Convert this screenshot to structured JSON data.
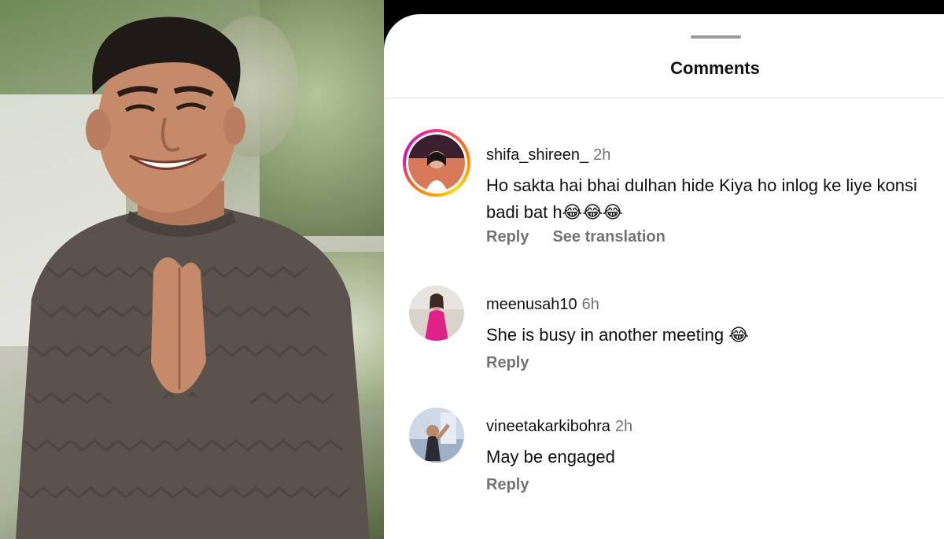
{
  "sheet": {
    "title": "Comments"
  },
  "comments": [
    {
      "username": "shifa_shireen_",
      "time": "2h",
      "text": "Ho sakta hai bhai dulhan hide Kiya ho inlog ke liye konsi badi bat h😂😂😂",
      "reply_label": "Reply",
      "translate_label": "See translation",
      "story_ring": true
    },
    {
      "username": "meenusah10",
      "time": "6h",
      "text": "She is busy in another meeting 😂",
      "reply_label": "Reply",
      "story_ring": false
    },
    {
      "username": "vineetakarkibohra",
      "time": "2h",
      "text": "May be engaged",
      "reply_label": "Reply",
      "story_ring": false
    }
  ],
  "colors": {
    "text_primary": "#111111",
    "text_secondary": "#737373",
    "divider": "#e2e2e2",
    "story_ring": "#ff2e8a"
  },
  "icons": {
    "emoji": "face-with-tears-of-joy"
  }
}
